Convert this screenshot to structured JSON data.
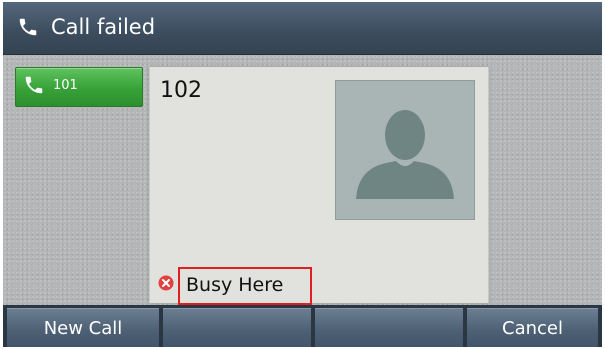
{
  "title_bar": {
    "title": "Call failed",
    "icon": "phone-handset-icon"
  },
  "line_keys": [
    {
      "label": "101",
      "icon": "phone-handset-icon",
      "color": "#37a237"
    }
  ],
  "call": {
    "remote_party": "102",
    "avatar": "person-silhouette-icon",
    "status_text": "Busy Here",
    "status_icon": "error-x-icon",
    "status_color": "#e04040",
    "highlight_color": "#e02020"
  },
  "softkeys": [
    {
      "label": "New Call"
    },
    {
      "label": ""
    },
    {
      "label": ""
    },
    {
      "label": "Cancel"
    }
  ]
}
